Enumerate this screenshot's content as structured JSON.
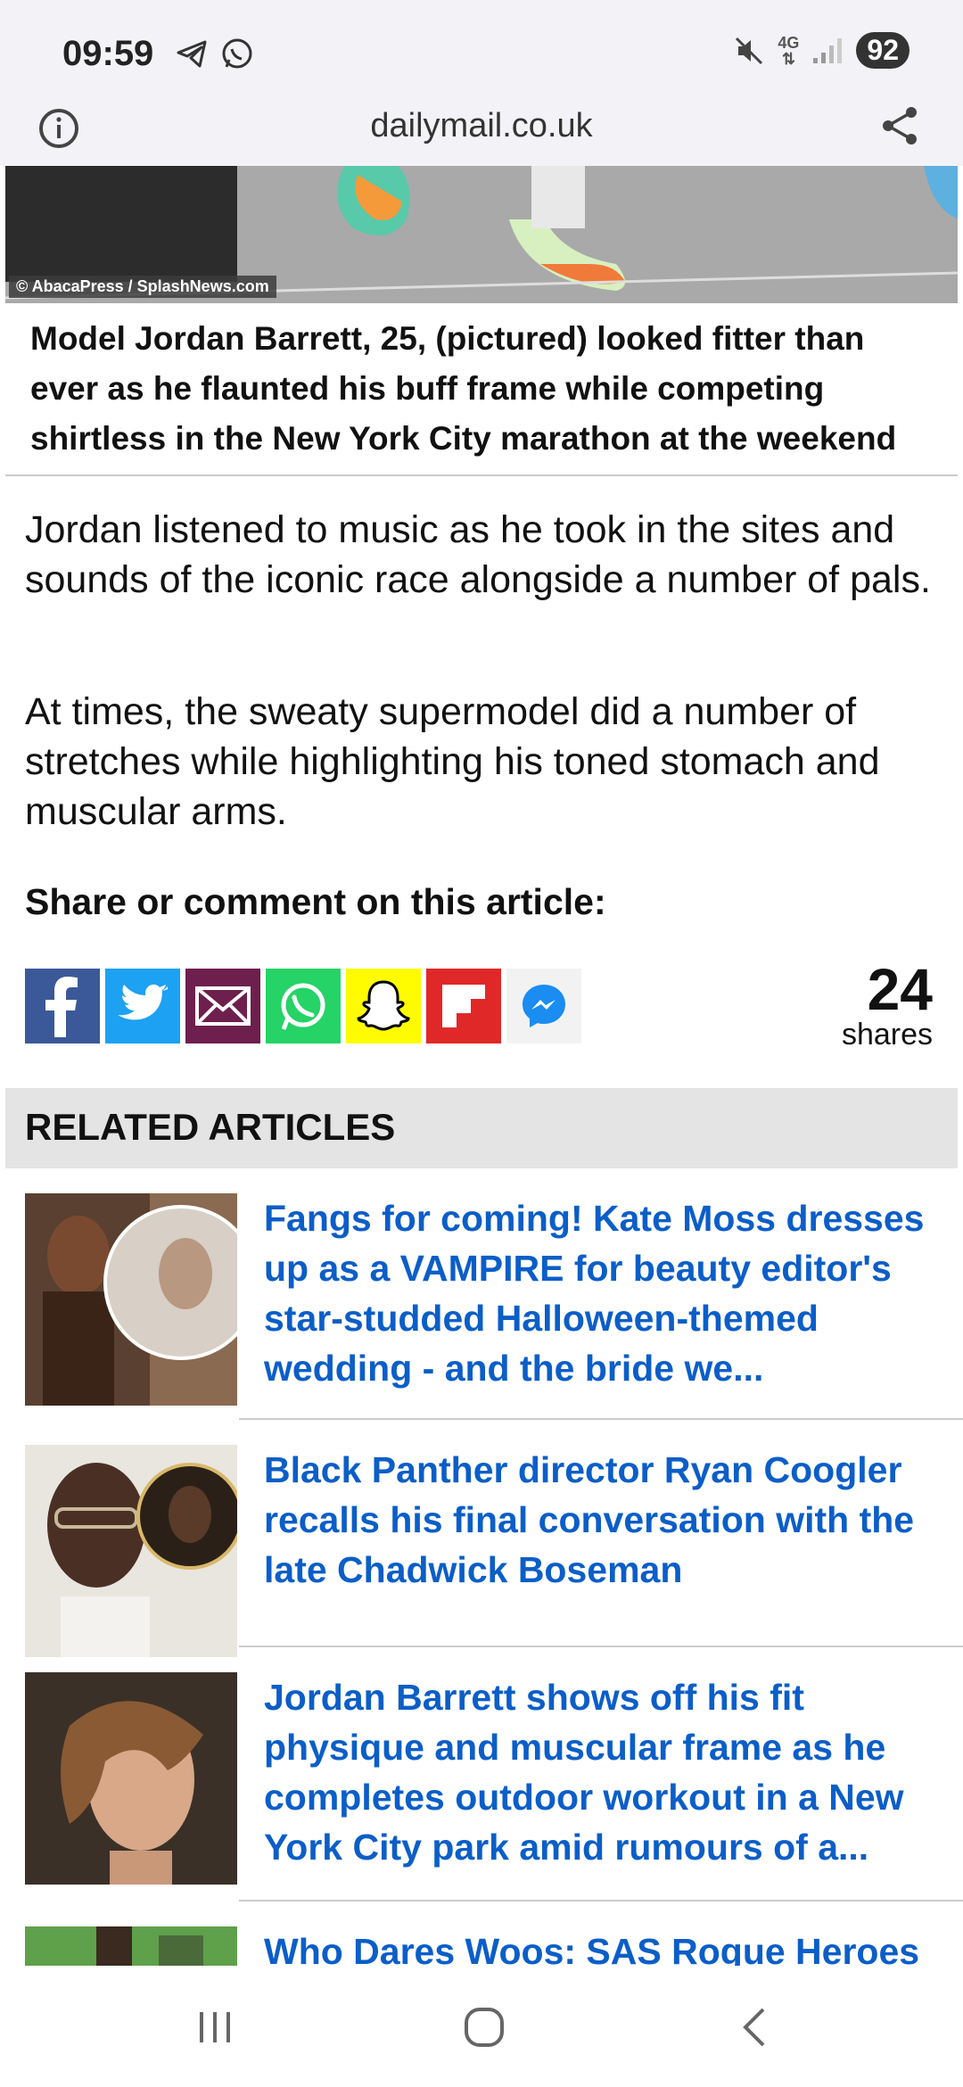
{
  "status": {
    "time": "09:59",
    "network": "4G",
    "battery": "92"
  },
  "browser": {
    "url": "dailymail.co.uk"
  },
  "hero": {
    "credit": "© AbacaPress / SplashNews.com"
  },
  "caption": "Model Jordan Barrett, 25, (pictured) looked fitter than ever as he flaunted his buff frame while competing shirtless in the New York City marathon at the weekend",
  "paragraphs": [
    "Jordan listened to music as he took in the sites and sounds of the iconic race alongside a number of pals.",
    "At times, the sweaty supermodel did a number of stretches while highlighting his toned stomach and muscular arms."
  ],
  "share": {
    "heading": "Share or comment on this article:",
    "count": "24",
    "count_label": "shares",
    "buttons": [
      "facebook-icon",
      "twitter-icon",
      "email-icon",
      "whatsapp-icon",
      "snapchat-icon",
      "flipboard-icon",
      "messenger-icon"
    ]
  },
  "related": {
    "heading": "RELATED ARTICLES",
    "items": [
      {
        "title": "Fangs for coming! Kate Moss dresses up as a VAMPIRE for beauty editor's star-studded Halloween-themed wedding - and the bride we..."
      },
      {
        "title": "Black Panther director Ryan Coogler recalls his final conversation with the late Chadwick Boseman"
      },
      {
        "title": "Jordan Barrett shows off his fit physique and muscular frame as he completes outdoor workout in a New York City park amid rumours of a..."
      },
      {
        "title": "Who Dares Woos: SAS Rogue Heroes"
      }
    ]
  },
  "colors": {
    "link": "#0b5ec8",
    "facebook": "#3b5998",
    "twitter": "#1da1f2",
    "email": "#6e1f4e",
    "whatsapp": "#25d366",
    "snapchat": "#fffc00",
    "flipboard": "#e12828"
  }
}
